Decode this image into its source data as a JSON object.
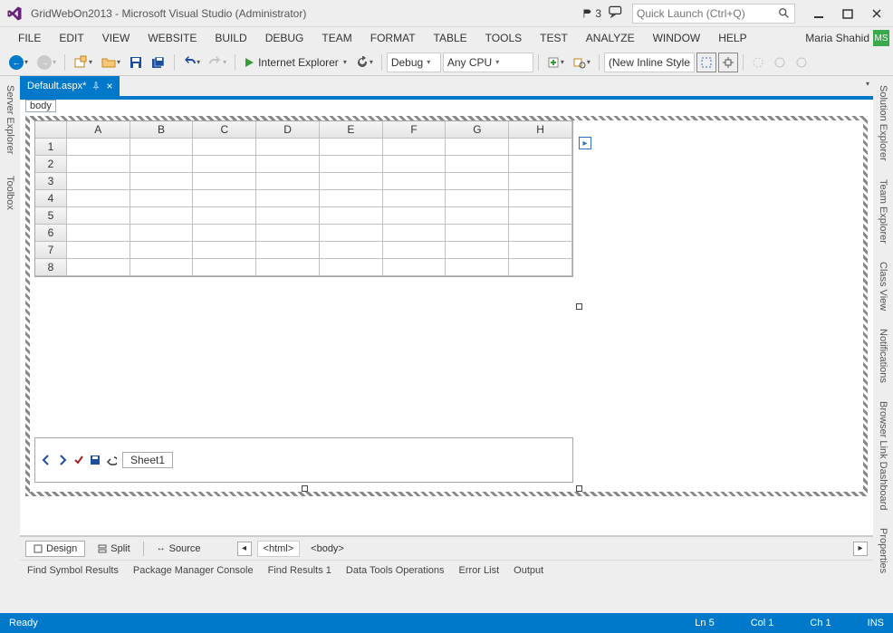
{
  "titlebar": {
    "title": "GridWebOn2013 - Microsoft Visual Studio (Administrator)",
    "notification_count": "3",
    "quicklaunch_placeholder": "Quick Launch (Ctrl+Q)"
  },
  "menubar": {
    "items": [
      "FILE",
      "EDIT",
      "VIEW",
      "WEBSITE",
      "BUILD",
      "DEBUG",
      "TEAM",
      "FORMAT",
      "TABLE",
      "TOOLS",
      "TEST",
      "ANALYZE",
      "WINDOW",
      "HELP"
    ],
    "user_name": "Maria Shahid",
    "user_initials": "MS"
  },
  "toolbar": {
    "run_target": "Internet Explorer",
    "config": "Debug",
    "platform": "Any CPU",
    "style_dropdown": "(New Inline Style"
  },
  "left_rail": {
    "tabs": [
      "Server Explorer",
      "Toolbox"
    ]
  },
  "right_rail": {
    "tabs": [
      "Solution Explorer",
      "Team Explorer",
      "Class View",
      "Notifications",
      "Browser Link Dashboard",
      "Properties"
    ]
  },
  "document": {
    "tab_name": "Default.aspx*",
    "body_tag": "body",
    "grid": {
      "columns": [
        "A",
        "B",
        "C",
        "D",
        "E",
        "F",
        "G",
        "H"
      ],
      "rows": [
        "1",
        "2",
        "3",
        "4",
        "5",
        "6",
        "7",
        "8"
      ],
      "sheet_name": "Sheet1"
    }
  },
  "viewtabs": {
    "design": "Design",
    "split": "Split",
    "source": "Source",
    "crumb_html": "<html>",
    "crumb_body": "<body>"
  },
  "tooltabs": [
    "Find Symbol Results",
    "Package Manager Console",
    "Find Results 1",
    "Data Tools Operations",
    "Error List",
    "Output"
  ],
  "statusbar": {
    "ready": "Ready",
    "line": "Ln 5",
    "col": "Col 1",
    "ch": "Ch 1",
    "ins": "INS"
  }
}
